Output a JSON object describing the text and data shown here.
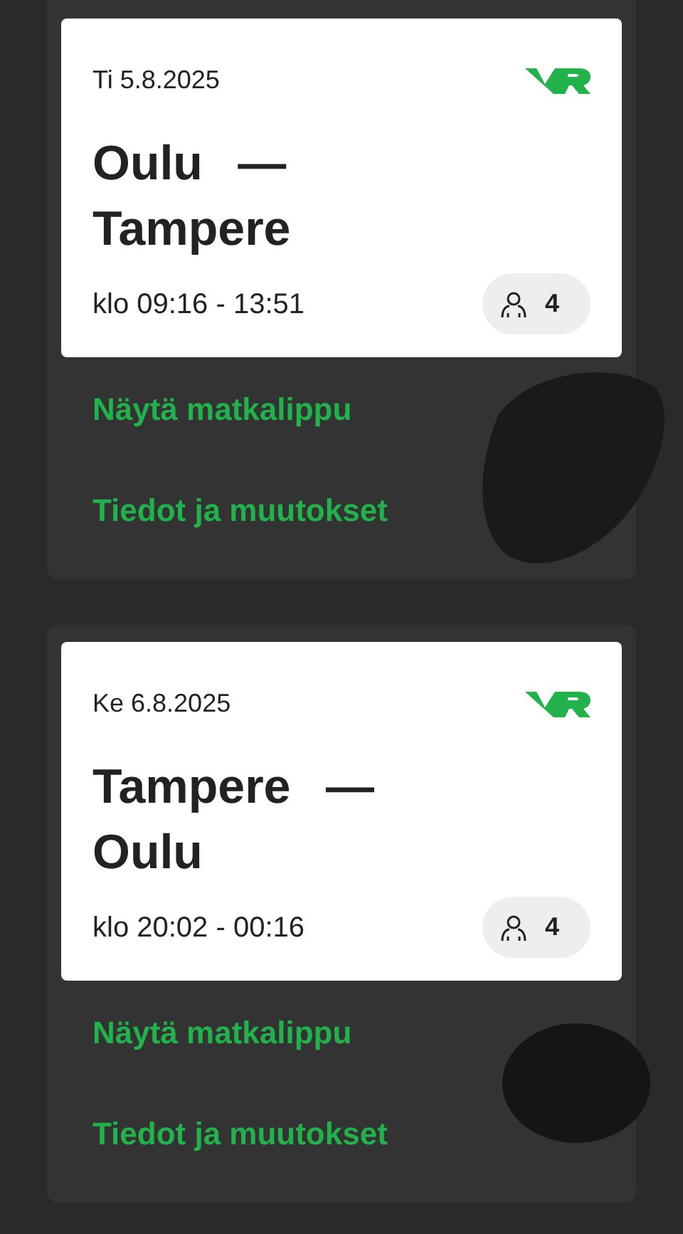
{
  "trips": [
    {
      "date": "Ti 5.8.2025",
      "route": "Oulu — Tampere",
      "time": "klo 09:16 - 13:51",
      "passengers": "4",
      "actions": [
        "Näytä matkalippu",
        "Tiedot ja muutokset"
      ]
    },
    {
      "date": "Ke 6.8.2025",
      "route": "Tampere — Oulu",
      "time": "klo 20:02 - 00:16",
      "passengers": "4",
      "actions": [
        "Näytä matkalippu",
        "Tiedot ja muutokset"
      ]
    }
  ]
}
